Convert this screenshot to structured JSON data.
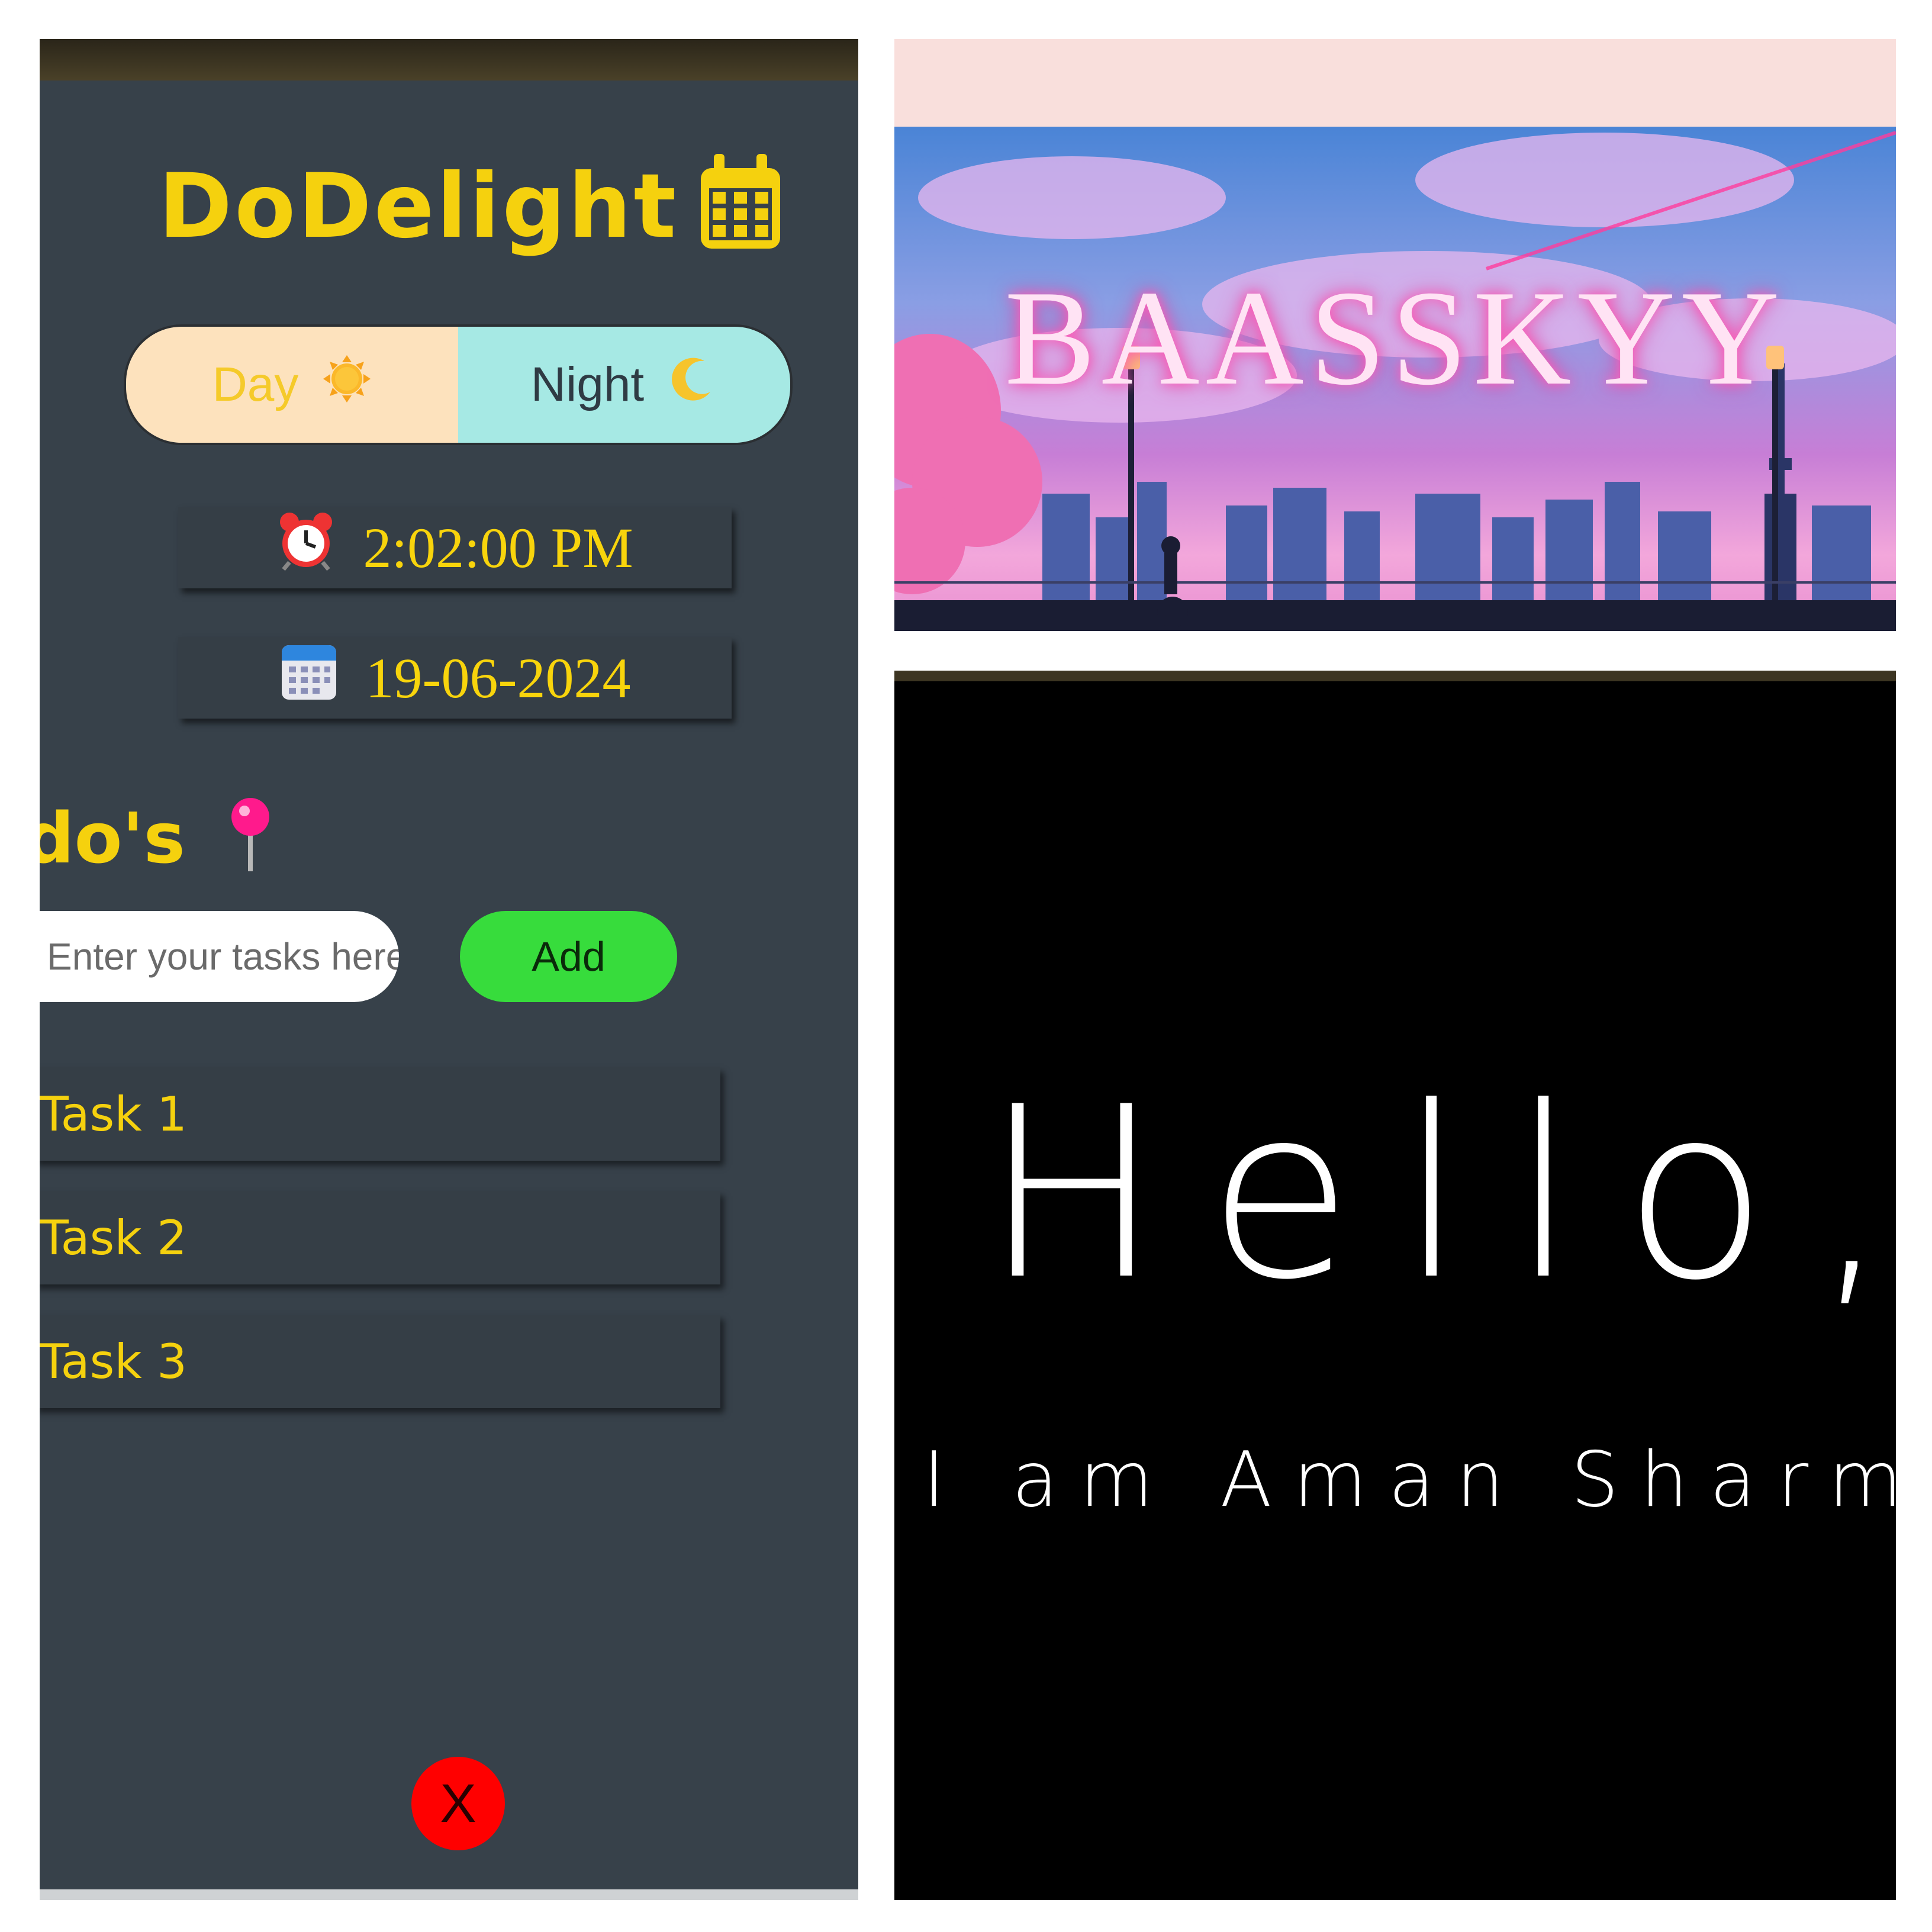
{
  "todo_app": {
    "title": "DoDelight",
    "title_icon": "calendar-icon",
    "mode_toggle": {
      "day_label": "Day",
      "day_icon": "sun-icon",
      "night_label": "Night",
      "night_icon": "crescent-moon-icon"
    },
    "clock": {
      "icon": "alarm-clock-icon",
      "value": "2:02:00 PM"
    },
    "date": {
      "icon": "calendar-icon",
      "value": "19-06-2024"
    },
    "section_title": "do's",
    "section_title_icon": "round-pushpin-icon",
    "task_input": {
      "placeholder": "Enter your tasks here",
      "value": ""
    },
    "add_button": "Add",
    "tasks": [
      "Task 1",
      "Task 2",
      "Task 3"
    ],
    "close_button": "X",
    "colors": {
      "background": "#37414a",
      "accent_yellow": "#f5d10e",
      "add_green": "#37dc3c",
      "close_red": "#ff0000",
      "day_bg": "#fde2bd",
      "night_bg": "#a6e9e4"
    }
  },
  "banner": {
    "title": "BAASSKYY",
    "background_top": "#f9dfdc"
  },
  "intro": {
    "greeting": "Hello,",
    "line": "I am Aman Sharma",
    "line_icon": "waving-hand-icon",
    "background": "#000000"
  }
}
